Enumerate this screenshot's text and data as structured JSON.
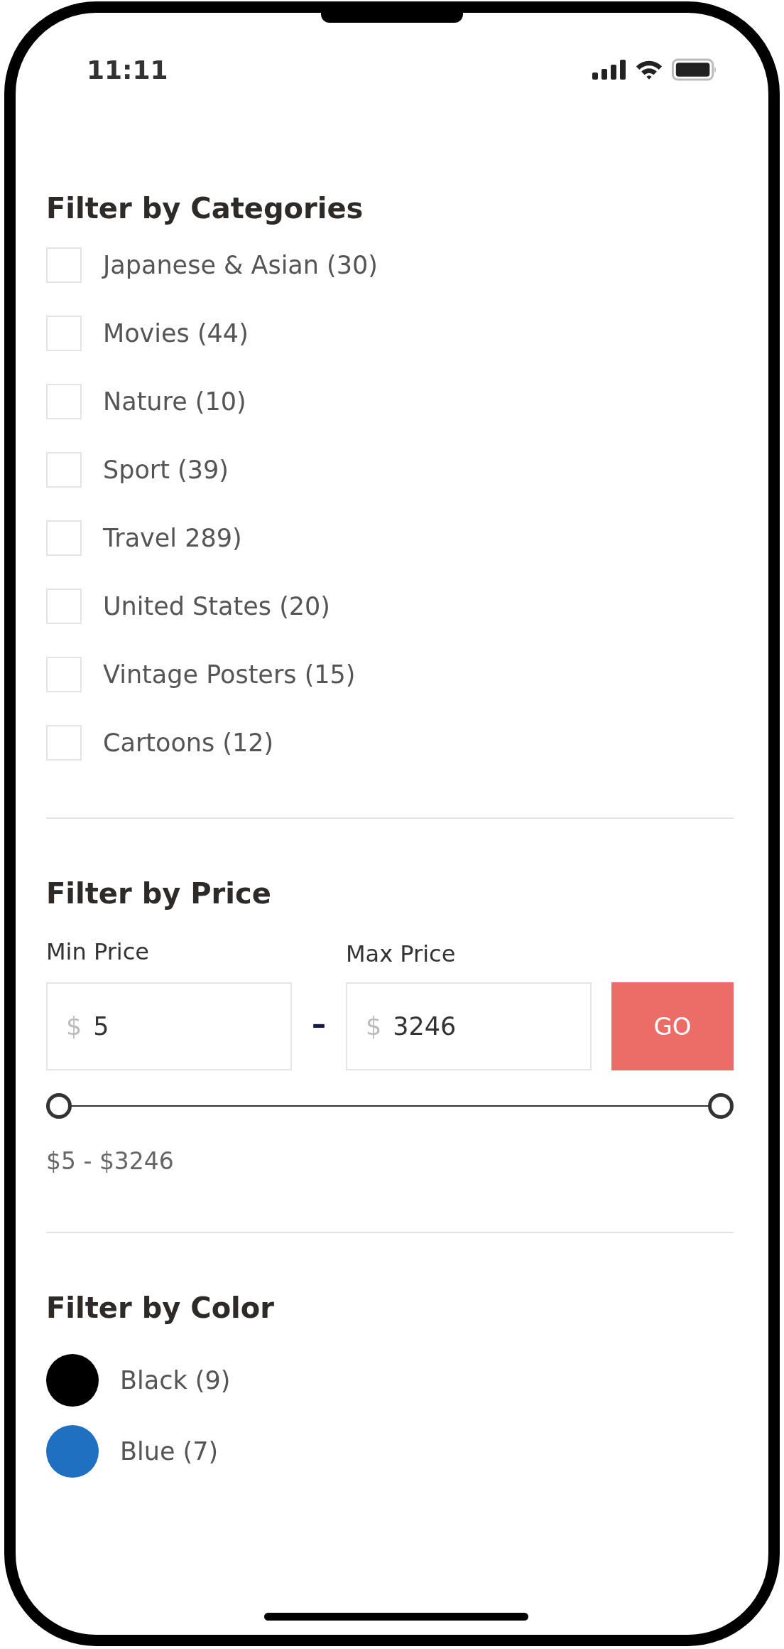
{
  "status_bar": {
    "time": "11:11"
  },
  "categories": {
    "title": "Filter by Categories",
    "items": [
      {
        "label": "Japanese & Asian (30)",
        "checked": false
      },
      {
        "label": "Movies (44)",
        "checked": false
      },
      {
        "label": "Nature (10)",
        "checked": false
      },
      {
        "label": "Sport (39)",
        "checked": false
      },
      {
        "label": "Travel 289)",
        "checked": false
      },
      {
        "label": "United States (20)",
        "checked": false
      },
      {
        "label": "Vintage Posters (15)",
        "checked": false
      },
      {
        "label": "Cartoons (12)",
        "checked": false
      }
    ]
  },
  "price": {
    "title": "Filter by Price",
    "min": {
      "label": "Min Price",
      "currency": "$",
      "value": "5"
    },
    "separator": "–",
    "max": {
      "label": "Max Price",
      "currency": "$",
      "value": "3246"
    },
    "button": "GO",
    "slider": {
      "thumbs": [
        {
          "level": 0
        },
        {
          "level": 1
        }
      ]
    },
    "range_text": "$5 - $3246"
  },
  "colors": {
    "title": "Filter by Color",
    "items": [
      {
        "label": "Black (9)",
        "color": "#000000"
      },
      {
        "label": "Blue (7)",
        "color": "#1f70c1"
      }
    ]
  }
}
